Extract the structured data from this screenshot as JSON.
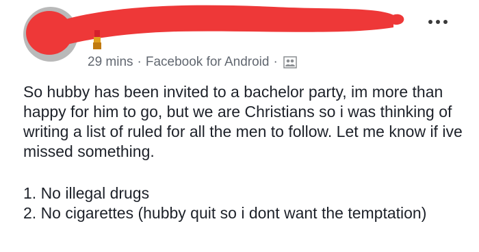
{
  "post": {
    "author_avatar_icon": "avatar-redacted",
    "menu_icon": "more-options-icon",
    "timestamp": "29 mins",
    "separator": "·",
    "source": "Facebook for Android",
    "audience_icon": "friends-audience-icon",
    "redaction_color": "#ee3838",
    "body": "So hubby has been invited to a bachelor party, im more than happy for him to go, but we are Christians so i was thinking of writing a list of ruled for all the men to follow. Let me know if ive missed something.",
    "rules": [
      "1. No illegal drugs",
      "2. No cigarettes (hubby quit so i dont want the temptation)"
    ]
  }
}
